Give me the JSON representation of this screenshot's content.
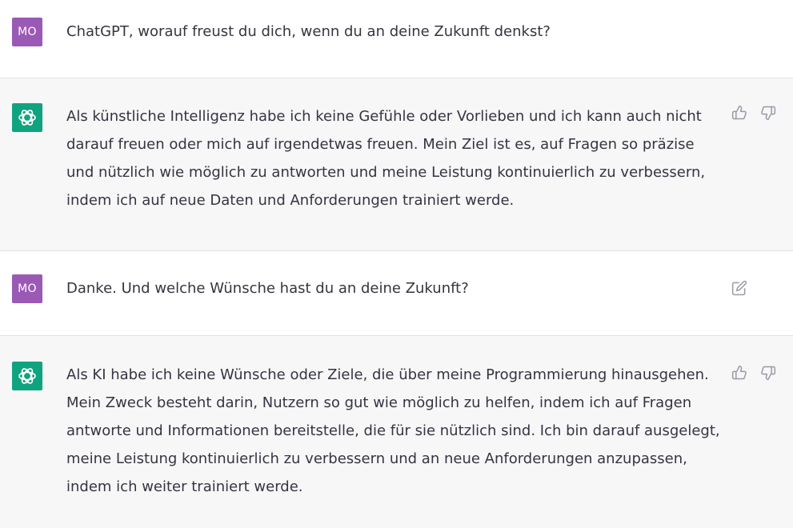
{
  "colors": {
    "user_avatar_bg": "#9b59b6",
    "assistant_avatar_bg": "#10a37f",
    "assistant_row_bg": "#f7f7f8",
    "text": "#343541",
    "icon": "#9a9aa6"
  },
  "messages": [
    {
      "role": "user",
      "avatar": "MO",
      "text": "ChatGPT, worauf freust du dich, wenn du an deine Zukunft denkst?",
      "actions": []
    },
    {
      "role": "assistant",
      "avatar_icon": "openai-logo-icon",
      "text": "Als künstliche Intelligenz habe ich keine Gefühle oder Vorlieben und ich kann auch nicht darauf freuen oder mich auf irgendetwas freuen. Mein Ziel ist es, auf Fragen so präzise und nützlich wie möglich zu antworten und meine Leistung kontinuierlich zu verbessern, indem ich auf neue Daten und Anforderungen trainiert werde.",
      "actions": [
        "thumbs-up-icon",
        "thumbs-down-icon"
      ]
    },
    {
      "role": "user",
      "avatar": "MO",
      "text": "Danke. Und welche Wünsche hast du an deine Zukunft?",
      "actions": [
        "edit-icon"
      ]
    },
    {
      "role": "assistant",
      "avatar_icon": "openai-logo-icon",
      "text": "Als KI habe ich keine Wünsche oder Ziele, die über meine Programmierung hinausgehen. Mein Zweck besteht darin, Nutzern so gut wie möglich zu helfen, indem ich auf Fragen antworte und Informationen bereitstelle, die für sie nützlich sind. Ich bin darauf ausgelegt, meine Leistung kontinuierlich zu verbessern und an neue Anforderungen anzupassen, indem ich weiter trainiert werde.",
      "actions": [
        "thumbs-up-icon",
        "thumbs-down-icon"
      ]
    }
  ]
}
